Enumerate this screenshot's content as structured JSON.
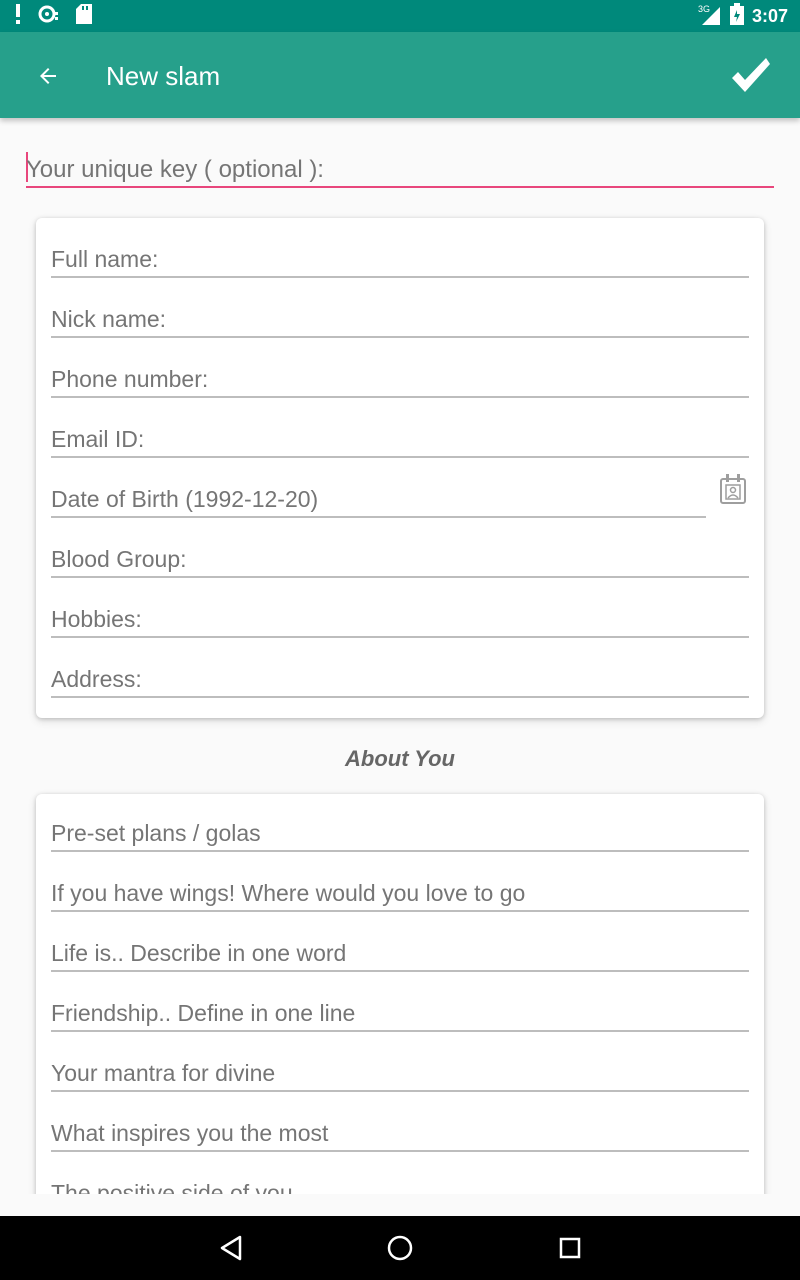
{
  "status_bar": {
    "time": "3:07",
    "network": "3G",
    "icons": [
      "alert-icon",
      "sync-icon",
      "sd-card-icon",
      "signal-icon",
      "battery-icon"
    ]
  },
  "app_bar": {
    "title": "New slam",
    "back_icon": "arrow-back-icon",
    "done_icon": "checkmark-icon",
    "background": "#26a08b",
    "status_background": "#00897b"
  },
  "unique_key": {
    "placeholder": "Your unique key ( optional ):",
    "accent": "#e8467c"
  },
  "personal_card": {
    "fields": [
      "Full name:",
      "Nick name:",
      "Phone number:",
      "Email ID:",
      "Date of Birth (1992-12-20)",
      "Blood Group:",
      "Hobbies:",
      "Address:"
    ],
    "date_picker_icon": "calendar-icon"
  },
  "about_section": {
    "title": "About You",
    "fields": [
      "Pre-set plans / golas",
      "If you have wings! Where would you love to go",
      "Life is.. Describe in one word",
      "Friendship.. Define in one line",
      "Your mantra for divine",
      "What inspires you the most",
      "The positive side of you"
    ]
  },
  "nav_bar": {
    "icons": [
      "back-triangle-icon",
      "home-circle-icon",
      "recents-square-icon"
    ]
  }
}
